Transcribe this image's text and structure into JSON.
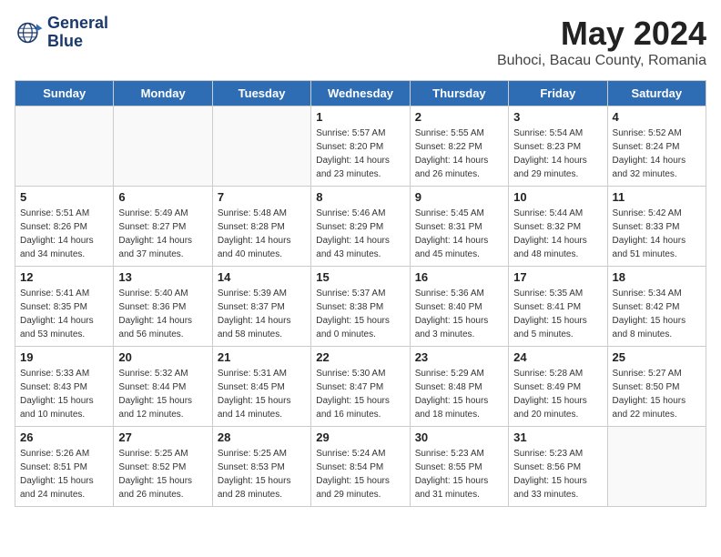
{
  "header": {
    "logo_line1": "General",
    "logo_line2": "Blue",
    "month": "May 2024",
    "location": "Buhoci, Bacau County, Romania"
  },
  "days_of_week": [
    "Sunday",
    "Monday",
    "Tuesday",
    "Wednesday",
    "Thursday",
    "Friday",
    "Saturday"
  ],
  "weeks": [
    [
      {
        "day": "",
        "info": ""
      },
      {
        "day": "",
        "info": ""
      },
      {
        "day": "",
        "info": ""
      },
      {
        "day": "1",
        "info": "Sunrise: 5:57 AM\nSunset: 8:20 PM\nDaylight: 14 hours\nand 23 minutes."
      },
      {
        "day": "2",
        "info": "Sunrise: 5:55 AM\nSunset: 8:22 PM\nDaylight: 14 hours\nand 26 minutes."
      },
      {
        "day": "3",
        "info": "Sunrise: 5:54 AM\nSunset: 8:23 PM\nDaylight: 14 hours\nand 29 minutes."
      },
      {
        "day": "4",
        "info": "Sunrise: 5:52 AM\nSunset: 8:24 PM\nDaylight: 14 hours\nand 32 minutes."
      }
    ],
    [
      {
        "day": "5",
        "info": "Sunrise: 5:51 AM\nSunset: 8:26 PM\nDaylight: 14 hours\nand 34 minutes."
      },
      {
        "day": "6",
        "info": "Sunrise: 5:49 AM\nSunset: 8:27 PM\nDaylight: 14 hours\nand 37 minutes."
      },
      {
        "day": "7",
        "info": "Sunrise: 5:48 AM\nSunset: 8:28 PM\nDaylight: 14 hours\nand 40 minutes."
      },
      {
        "day": "8",
        "info": "Sunrise: 5:46 AM\nSunset: 8:29 PM\nDaylight: 14 hours\nand 43 minutes."
      },
      {
        "day": "9",
        "info": "Sunrise: 5:45 AM\nSunset: 8:31 PM\nDaylight: 14 hours\nand 45 minutes."
      },
      {
        "day": "10",
        "info": "Sunrise: 5:44 AM\nSunset: 8:32 PM\nDaylight: 14 hours\nand 48 minutes."
      },
      {
        "day": "11",
        "info": "Sunrise: 5:42 AM\nSunset: 8:33 PM\nDaylight: 14 hours\nand 51 minutes."
      }
    ],
    [
      {
        "day": "12",
        "info": "Sunrise: 5:41 AM\nSunset: 8:35 PM\nDaylight: 14 hours\nand 53 minutes."
      },
      {
        "day": "13",
        "info": "Sunrise: 5:40 AM\nSunset: 8:36 PM\nDaylight: 14 hours\nand 56 minutes."
      },
      {
        "day": "14",
        "info": "Sunrise: 5:39 AM\nSunset: 8:37 PM\nDaylight: 14 hours\nand 58 minutes."
      },
      {
        "day": "15",
        "info": "Sunrise: 5:37 AM\nSunset: 8:38 PM\nDaylight: 15 hours\nand 0 minutes."
      },
      {
        "day": "16",
        "info": "Sunrise: 5:36 AM\nSunset: 8:40 PM\nDaylight: 15 hours\nand 3 minutes."
      },
      {
        "day": "17",
        "info": "Sunrise: 5:35 AM\nSunset: 8:41 PM\nDaylight: 15 hours\nand 5 minutes."
      },
      {
        "day": "18",
        "info": "Sunrise: 5:34 AM\nSunset: 8:42 PM\nDaylight: 15 hours\nand 8 minutes."
      }
    ],
    [
      {
        "day": "19",
        "info": "Sunrise: 5:33 AM\nSunset: 8:43 PM\nDaylight: 15 hours\nand 10 minutes."
      },
      {
        "day": "20",
        "info": "Sunrise: 5:32 AM\nSunset: 8:44 PM\nDaylight: 15 hours\nand 12 minutes."
      },
      {
        "day": "21",
        "info": "Sunrise: 5:31 AM\nSunset: 8:45 PM\nDaylight: 15 hours\nand 14 minutes."
      },
      {
        "day": "22",
        "info": "Sunrise: 5:30 AM\nSunset: 8:47 PM\nDaylight: 15 hours\nand 16 minutes."
      },
      {
        "day": "23",
        "info": "Sunrise: 5:29 AM\nSunset: 8:48 PM\nDaylight: 15 hours\nand 18 minutes."
      },
      {
        "day": "24",
        "info": "Sunrise: 5:28 AM\nSunset: 8:49 PM\nDaylight: 15 hours\nand 20 minutes."
      },
      {
        "day": "25",
        "info": "Sunrise: 5:27 AM\nSunset: 8:50 PM\nDaylight: 15 hours\nand 22 minutes."
      }
    ],
    [
      {
        "day": "26",
        "info": "Sunrise: 5:26 AM\nSunset: 8:51 PM\nDaylight: 15 hours\nand 24 minutes."
      },
      {
        "day": "27",
        "info": "Sunrise: 5:25 AM\nSunset: 8:52 PM\nDaylight: 15 hours\nand 26 minutes."
      },
      {
        "day": "28",
        "info": "Sunrise: 5:25 AM\nSunset: 8:53 PM\nDaylight: 15 hours\nand 28 minutes."
      },
      {
        "day": "29",
        "info": "Sunrise: 5:24 AM\nSunset: 8:54 PM\nDaylight: 15 hours\nand 29 minutes."
      },
      {
        "day": "30",
        "info": "Sunrise: 5:23 AM\nSunset: 8:55 PM\nDaylight: 15 hours\nand 31 minutes."
      },
      {
        "day": "31",
        "info": "Sunrise: 5:23 AM\nSunset: 8:56 PM\nDaylight: 15 hours\nand 33 minutes."
      },
      {
        "day": "",
        "info": ""
      }
    ]
  ]
}
